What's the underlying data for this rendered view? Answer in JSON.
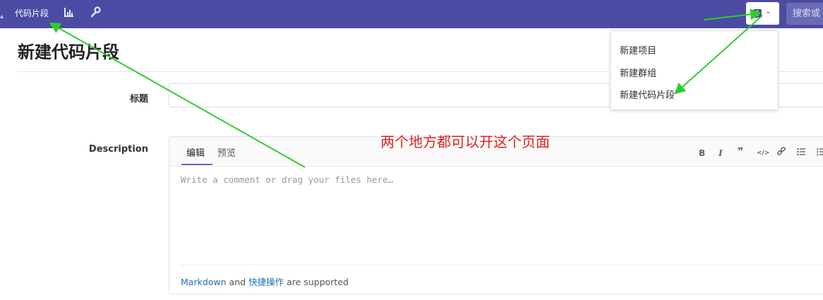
{
  "navbar": {
    "snippets_link": "代码片段",
    "search_placeholder": "搜索或",
    "icons": [
      "chart-icon",
      "wrench-icon",
      "plus-square-icon",
      "chevron-down-icon"
    ]
  },
  "page": {
    "title": "新建代码片段"
  },
  "form": {
    "title_label": "标题",
    "description_label": "Description",
    "tabs": [
      "编辑",
      "预览"
    ],
    "toolbar": [
      "B",
      "I",
      "❞",
      "</>",
      "link-icon",
      "bullet-list-icon",
      "numbered-list-icon"
    ],
    "placeholder": "Write a comment or drag your files here…",
    "footer": {
      "markdown_link": "Markdown",
      "and": "and",
      "quick_actions_link": "快捷操作",
      "suffix": "are supported"
    }
  },
  "dropdown": {
    "items": [
      "新建项目",
      "新建群组",
      "新建代码片段"
    ]
  },
  "annotation": {
    "note": "两个地方都可以开这个页面",
    "arrow_color": "#2ecc2e"
  },
  "colors": {
    "navbar": "#4b4ba3",
    "link": "#1f6fb2",
    "annotation_text": "#e02020"
  }
}
